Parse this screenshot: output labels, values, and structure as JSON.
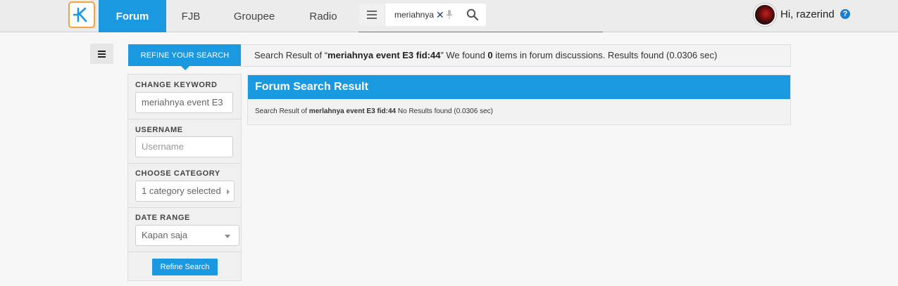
{
  "nav": {
    "tabs": [
      {
        "label": "Forum",
        "active": true
      },
      {
        "label": "FJB",
        "active": false
      },
      {
        "label": "Groupee",
        "active": false
      },
      {
        "label": "Radio",
        "active": false
      }
    ],
    "search_value": "meriahnya",
    "user_greeting": "Hi, razerind",
    "help_glyph": "?",
    "accent_color": "#1a98e0",
    "logo_border_color": "#f7a13a"
  },
  "refine": {
    "tab_label": "REFINE YOUR SEARCH"
  },
  "summary": {
    "prefix": "Search Result of “",
    "query": "meriahnya event E3 fid:44",
    "middle": "” We found ",
    "count": "0",
    "suffix": " items in forum discussions. Results found (0.0306 sec)"
  },
  "filters": {
    "keyword_label": "CHANGE KEYWORD",
    "keyword_value": "meriahnya event E3",
    "username_label": "USERNAME",
    "username_placeholder": "Username",
    "category_label": "CHOOSE CATEGORY",
    "category_value": "1 category selected",
    "date_label": "DATE RANGE",
    "date_value": "Kapan saja",
    "refine_button": "Refine Search"
  },
  "result": {
    "heading": "Forum Search Result",
    "body_prefix": "Search Result of ",
    "body_query": "merlahnya event E3 fid:44",
    "body_suffix": " No Results found (0.0306 sec)"
  },
  "icons": [
    "kaskus-logo-icon",
    "hamburger-icon",
    "close-icon",
    "microphone-icon",
    "search-icon",
    "help-icon",
    "sidebar-toggle-icon"
  ]
}
